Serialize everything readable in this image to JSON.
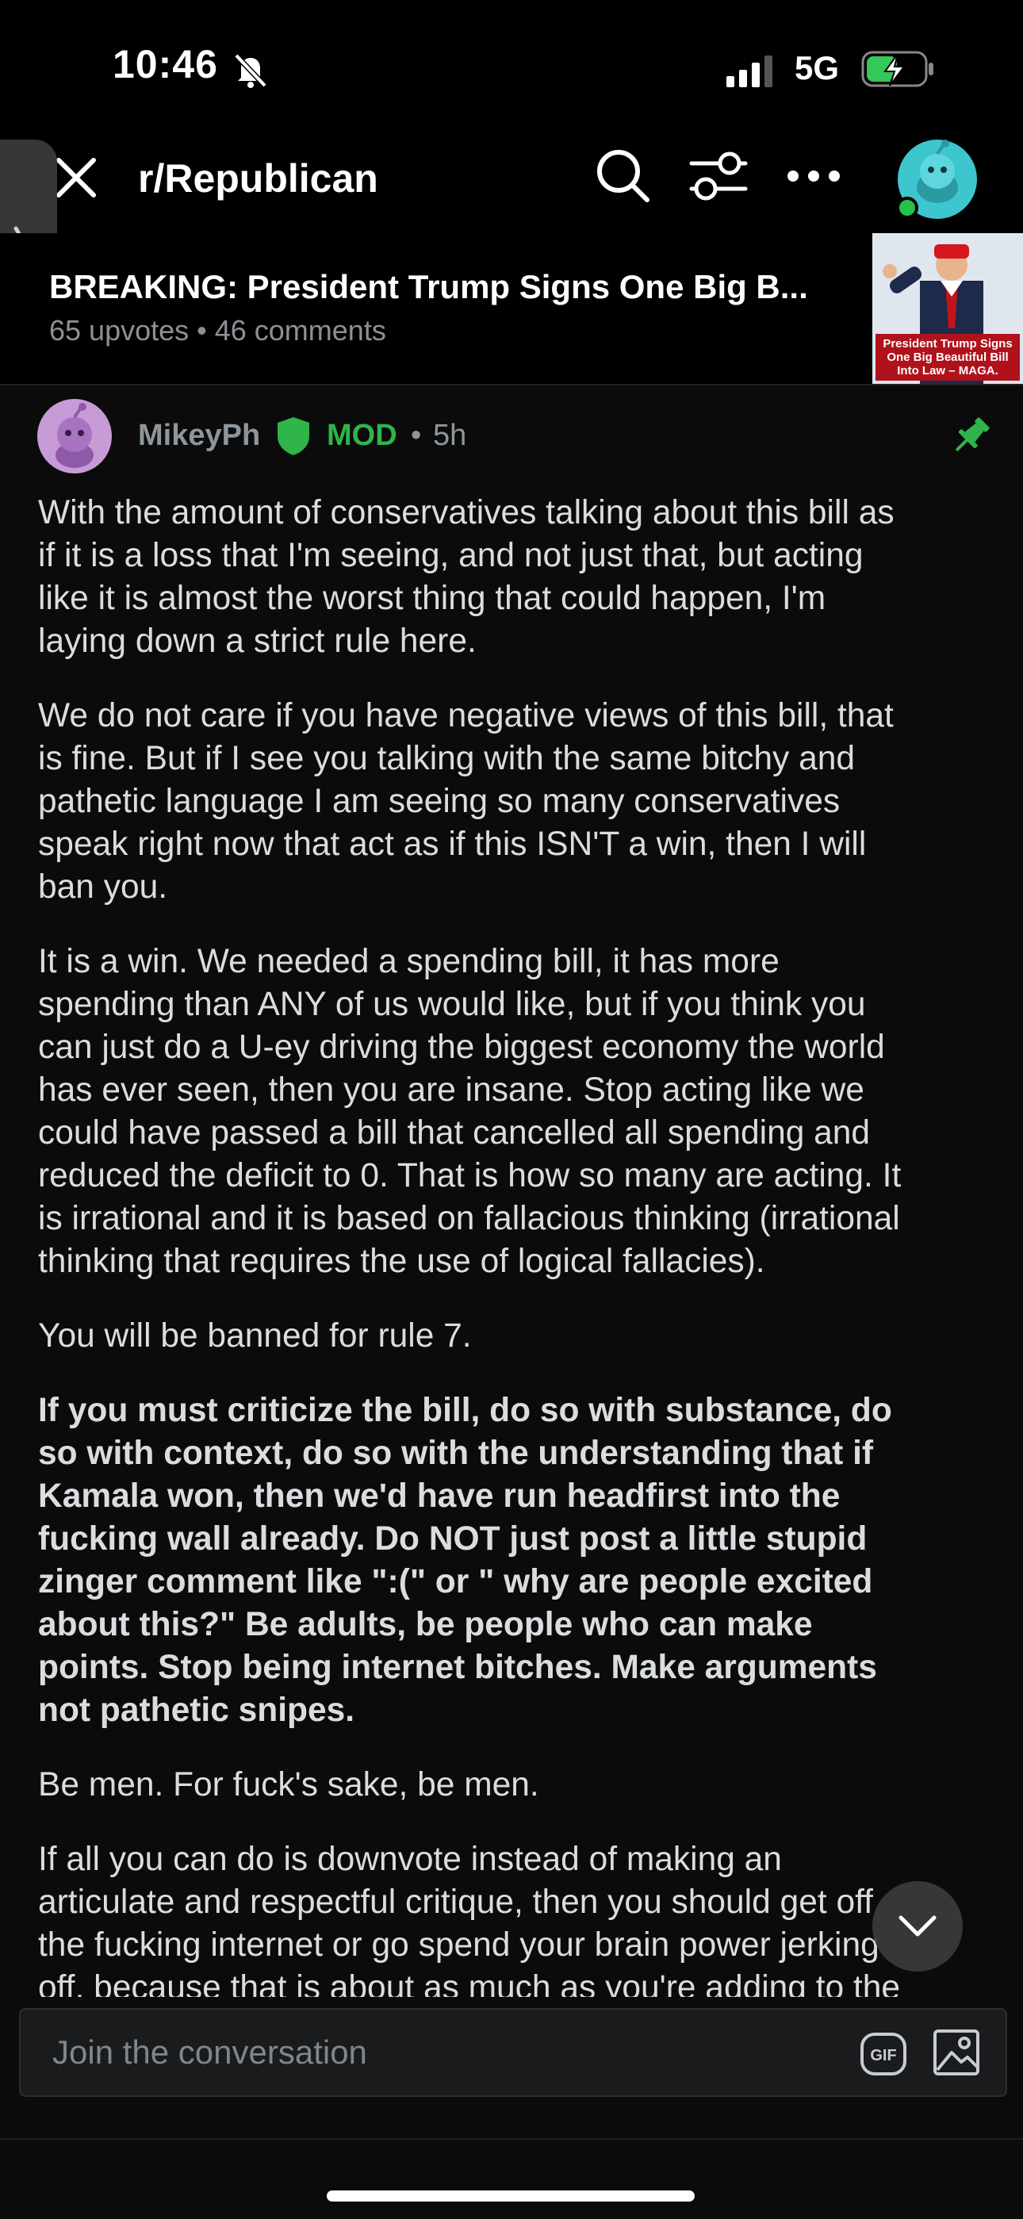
{
  "status_bar": {
    "time": "10:46",
    "network": "5G",
    "icons": [
      "bell-slash-icon",
      "cellular-signal-icon",
      "battery-charging-icon"
    ]
  },
  "nav": {
    "subreddit": "r/Republican",
    "icons": [
      "close-icon",
      "search-icon",
      "filter-icon",
      "more-icon",
      "avatar-icon"
    ]
  },
  "post": {
    "title": "BREAKING: President Trump Signs One Big B...",
    "meta": "65 upvotes • 46 comments",
    "thumbnail_caption": "President Trump Signs One Big Beautiful Bill Into Law – MAGA."
  },
  "comment": {
    "author": "MikeyPh",
    "badge": "MOD",
    "separator": "•",
    "age": "5h",
    "paragraphs": [
      {
        "bold": false,
        "lines": [
          "With the amount of conservatives talking about this bill as",
          "if it is a loss that I'm seeing, and not just that, but acting",
          "like it is almost the worst thing that could happen, I'm",
          "laying down a strict rule here."
        ]
      },
      {
        "bold": false,
        "lines": [
          "We do not care if you have negative views of this bill, that",
          "is fine. But if I see you talking with the same bitchy and",
          "pathetic language I am seeing so many conservatives",
          "speak right now that act as if this ISN'T a win, then I will",
          "ban you."
        ]
      },
      {
        "bold": false,
        "lines": [
          "It is a win. We needed a spending bill, it has more",
          "spending than ANY of us would like, but if you think you",
          "can just do a U-ey driving the biggest economy the world",
          "has ever seen, then you are insane. Stop acting like we",
          "could have passed a bill that cancelled all spending and",
          "reduced the deficit to 0. That is how so many are acting. It",
          "is irrational and it is based on fallacious thinking (irrational",
          "thinking that requires the use of logical fallacies)."
        ]
      },
      {
        "bold": false,
        "lines": [
          "You will be banned for rule 7."
        ]
      },
      {
        "bold": true,
        "lines": [
          "If you must criticize the bill, do so with substance, do",
          "so with context, do so with the understanding that if",
          "Kamala won, then we'd have run headfirst into the",
          "fucking wall already. Do NOT just post a little stupid",
          "zinger comment like \":(\" or \" why are people excited",
          "about this?\" Be adults, be people who can make",
          "points. Stop being internet bitches. Make arguments",
          "not pathetic snipes."
        ]
      },
      {
        "bold": false,
        "lines": [
          "Be men. For fuck's sake, be men."
        ]
      },
      {
        "bold": false,
        "lines": [
          "If all you can do is downvote instead of making an",
          "articulate and respectful critique, then you should get off",
          "the fucking internet or go spend your brain power jerking",
          "off, because that is about as much as you're adding to the"
        ]
      }
    ]
  },
  "compose": {
    "placeholder": "Join the conversation",
    "gif_label": "GIF"
  },
  "colors": {
    "background": "#0b0b0b",
    "mod_green": "#2fb54a",
    "avatar_teal": "#3ec6cf",
    "user_avatar_purple": "#c79bd6"
  }
}
